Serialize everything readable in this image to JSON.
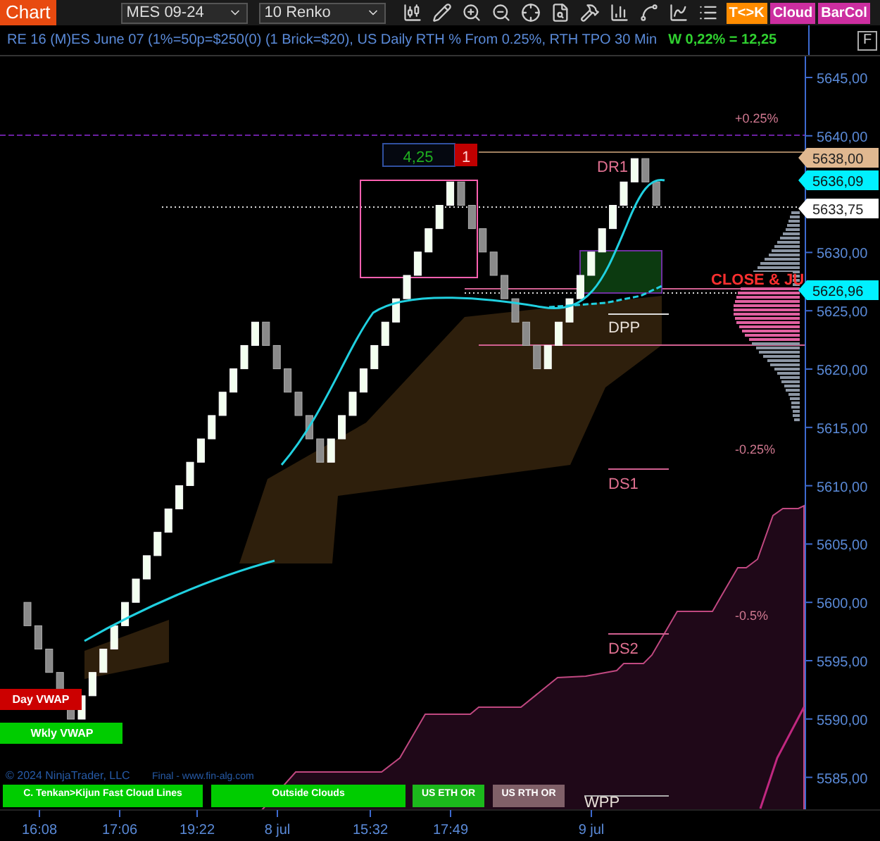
{
  "toolbar": {
    "tab": "Chart",
    "instrument": "MES 09-24",
    "bar_type": "10 Renko",
    "buttons": [
      {
        "label": "T<>K",
        "color": "#ff8c00"
      },
      {
        "label": "Cloud",
        "color": "#cc2ea0"
      },
      {
        "label": "BarCol",
        "color": "#cc2ea0"
      }
    ]
  },
  "header": {
    "title": "RE 16 (M)ES June 07 (1%=50p=$250(0) (1 Brick=$20), US Daily RTH % From 0.25%, RTH TPO 30 Min",
    "indicator": "W 0,22% = 12,25",
    "button": "F"
  },
  "chart": {
    "price_axis": [
      "5645,00",
      "5640,00",
      "5630,00",
      "5625,00",
      "5620,00",
      "5615,00",
      "5610,00",
      "5605,00",
      "5600,00",
      "5595,00",
      "5590,00",
      "5585,00"
    ],
    "price_badges": [
      {
        "text": "5638,00",
        "kind": "level"
      },
      {
        "text": "5636,09",
        "kind": "average"
      },
      {
        "text": "5633,75",
        "kind": "last"
      },
      {
        "text": "5626,96",
        "kind": "average"
      }
    ],
    "level_labels": [
      {
        "text": "+0.25%",
        "kind": "percent"
      },
      {
        "text": "DR1",
        "kind": "pivot"
      },
      {
        "text": "CLOSE & JU",
        "kind": "close"
      },
      {
        "text": "DPP",
        "kind": "center"
      },
      {
        "text": "-0.25%",
        "kind": "percent"
      },
      {
        "text": "DS1",
        "kind": "pivot"
      },
      {
        "text": "-0.5%",
        "kind": "percent"
      },
      {
        "text": "DS2",
        "kind": "pivot"
      },
      {
        "text": "WPP",
        "kind": "center"
      }
    ],
    "range_box": {
      "value": "4,25",
      "count": "1"
    },
    "vwap_tags": [
      {
        "label": "Day VWAP",
        "color": "#cc0000"
      },
      {
        "label": "Wkly VWAP",
        "color": "#00cc00"
      }
    ],
    "legend_buttons": [
      {
        "label": "C. Tenkan>Kijun Fast Cloud Lines",
        "color": "#00cc00"
      },
      {
        "label": "Outside Clouds",
        "color": "#00cc00"
      },
      {
        "label": "US ETH OR",
        "color": "#1cb81c"
      },
      {
        "label": "US RTH OR",
        "color": "#806068"
      }
    ],
    "copyright": "© 2024 NinjaTrader, LLC",
    "credit": "Final - www.fin-alg.com",
    "time_axis": [
      "16:08",
      "17:06",
      "19:22",
      "8 jul",
      "15:32",
      "17:49",
      "9 jul"
    ]
  }
}
